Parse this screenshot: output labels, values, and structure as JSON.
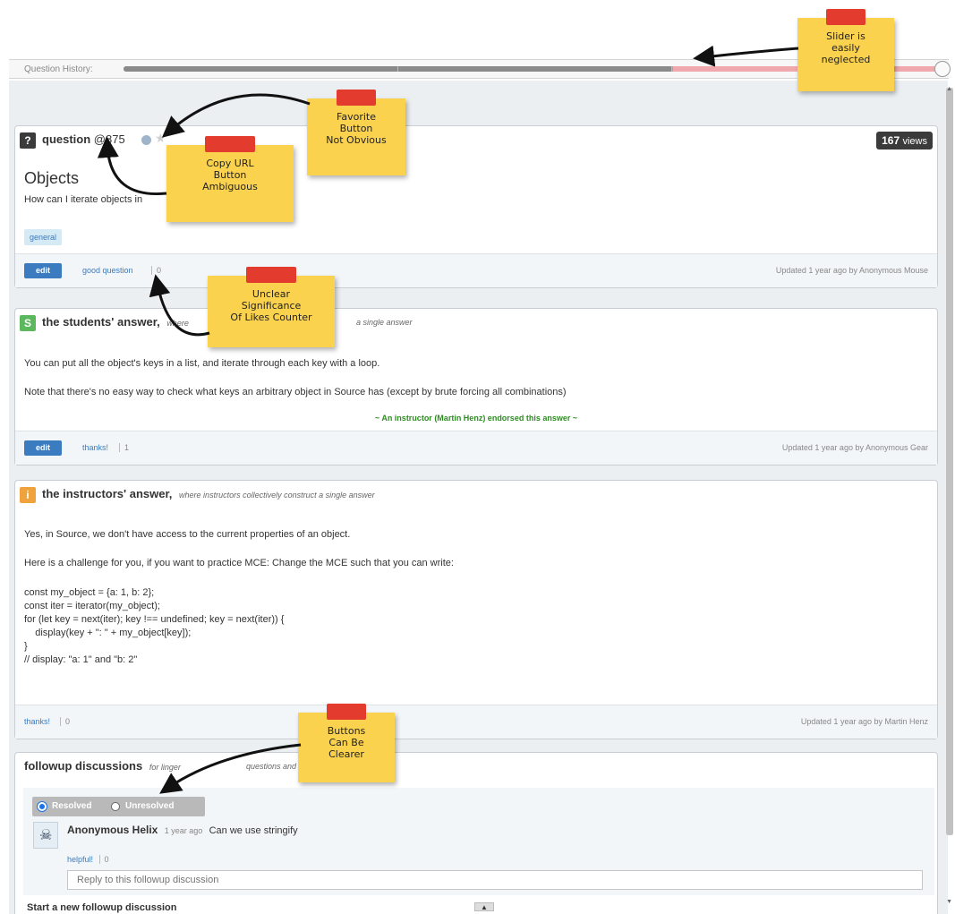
{
  "history": {
    "label": "Question History:"
  },
  "question": {
    "title_prefix": "question",
    "id": "@875",
    "views_count": "167",
    "views_unit": "views",
    "heading": "Objects",
    "body": "How can I iterate objects in",
    "tag": "general",
    "edit_label": "edit",
    "good_question_label": "good question",
    "good_question_count": "0",
    "updated": "Updated 1 year ago by Anonymous Mouse"
  },
  "students_answer": {
    "badge": "S",
    "title": "the students' answer,",
    "subtitle": "where",
    "subtitle_tail": "a single answer",
    "para1": "You can put all the object's keys in a list, and iterate through each key with a loop.",
    "para2": "Note that there's no easy way to check what keys an arbitrary object in Source has (except by brute forcing all combinations)",
    "endorse": "~ An instructor (Martin Henz) endorsed this answer ~",
    "edit_label": "edit",
    "thanks_label": "thanks!",
    "thanks_count": "1",
    "updated": "Updated 1 year ago by Anonymous Gear"
  },
  "instructors_answer": {
    "badge": "i",
    "title": "the instructors' answer,",
    "subtitle": "where instructors collectively construct a single answer",
    "para1": "Yes, in Source, we don't have access to the current properties of an object.",
    "para2": "Here is a challenge for you, if you want to practice MCE: Change the MCE such that you can write:",
    "code": "const my_object = {a: 1, b: 2};\nconst iter = iterator(my_object);\nfor (let key = next(iter); key !== undefined; key = next(iter)) {\n    display(key + \": \" + my_object[key]);\n}\n// display: \"a: 1\" and \"b: 2\"",
    "thanks_label": "thanks!",
    "thanks_count": "0",
    "updated": "Updated 1 year ago by Martin Henz"
  },
  "followup": {
    "title": "followup discussions",
    "subtitle": "for linger",
    "subtitle_tail": "questions and com",
    "resolved_label": "Resolved",
    "unresolved_label": "Unresolved",
    "author": "Anonymous Helix",
    "time": "1 year ago",
    "message": "Can we use stringify",
    "helpful_label": "helpful!",
    "helpful_count": "0",
    "reply_placeholder": "Reply to this followup discussion",
    "new_discussion": "Start a new followup discussion"
  },
  "notes": {
    "slider": "Slider is\neasily\nneglected",
    "favorite": "Favorite\nButton\nNot Obvious",
    "copy_url": "Copy URL\nButton\nAmbiguous",
    "likes": "Unclear\nSignificance\nOf Likes Counter",
    "buttons": "Buttons\nCan Be\nClearer"
  },
  "colors": {
    "note_yellow": "#fbd24e",
    "tape_red": "#e33b2e",
    "link_blue": "#3b7bbf",
    "endorse_green": "#2e8b22"
  }
}
